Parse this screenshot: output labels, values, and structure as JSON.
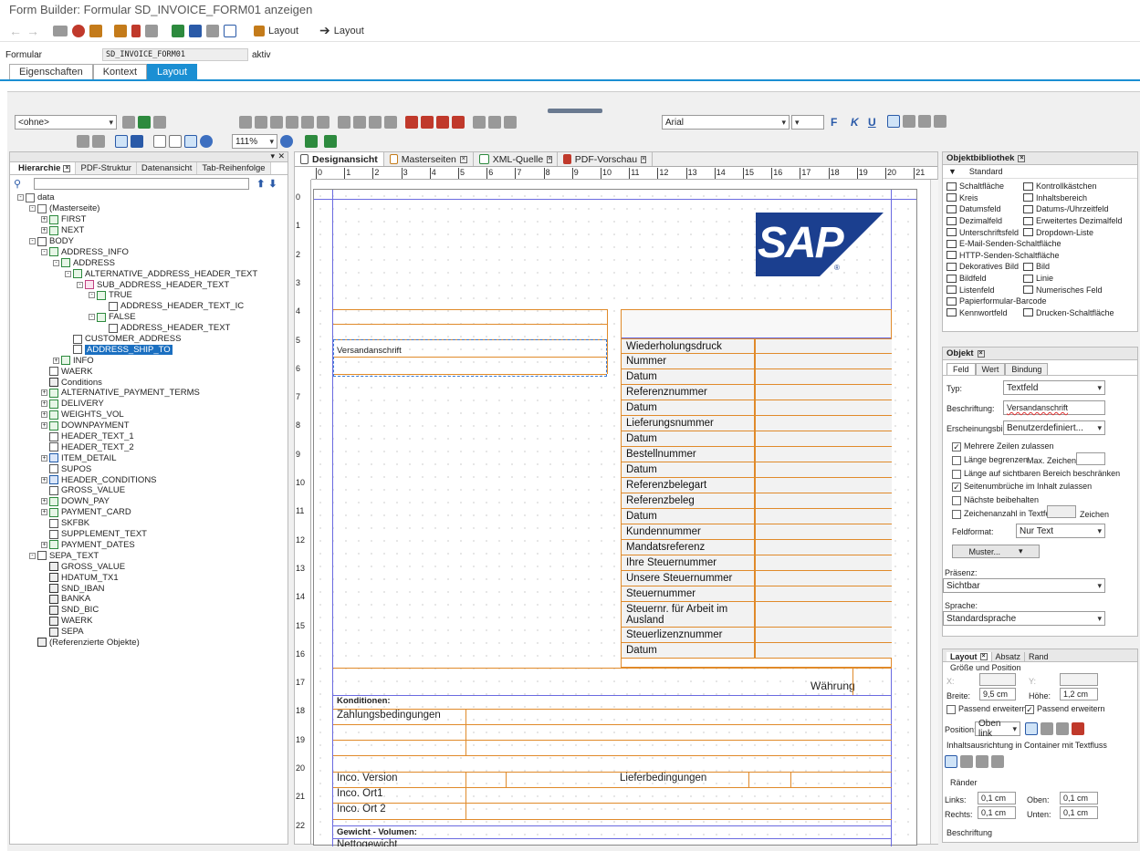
{
  "window": {
    "title": "Form Builder: Formular SD_INVOICE_FORM01 anzeigen"
  },
  "toolbar": {
    "layout_btn_1": "Layout",
    "layout_btn_2": "Layout"
  },
  "form": {
    "label": "Formular",
    "value": "SD_INVOICE_FORM01",
    "status": "aktiv"
  },
  "main_tabs": [
    {
      "label": "Eigenschaften"
    },
    {
      "label": "Kontext"
    },
    {
      "label": "Layout"
    }
  ],
  "design_toolbar": {
    "style_select": "<ohne>",
    "zoom": "111%",
    "font": "Arial"
  },
  "format_buttons": {
    "bold": "F",
    "italic": "K",
    "underline": "U"
  },
  "left_tabs": [
    {
      "label": "Hierarchie"
    },
    {
      "label": "PDF-Struktur"
    },
    {
      "label": "Datenansicht"
    },
    {
      "label": "Tab-Reihenfolge"
    }
  ],
  "tree": [
    {
      "label": "data",
      "level": 0,
      "icon": "page",
      "exp": "-"
    },
    {
      "label": "(Masterseite)",
      "level": 1,
      "icon": "page",
      "exp": "-"
    },
    {
      "label": "FIRST",
      "level": 2,
      "icon": "sub",
      "exp": "+"
    },
    {
      "label": "NEXT",
      "level": 2,
      "icon": "sub",
      "exp": "+"
    },
    {
      "label": "BODY",
      "level": 1,
      "icon": "fld",
      "exp": "-"
    },
    {
      "label": "ADDRESS_INFO",
      "level": 2,
      "icon": "sub",
      "exp": "-"
    },
    {
      "label": "ADDRESS",
      "level": 3,
      "icon": "sub",
      "exp": "-"
    },
    {
      "label": "ALTERNATIVE_ADDRESS_HEADER_TEXT",
      "level": 4,
      "icon": "sub",
      "exp": "-"
    },
    {
      "label": "SUB_ADDRESS_HEADER_TEXT",
      "level": 5,
      "icon": "pg",
      "exp": "-"
    },
    {
      "label": "TRUE",
      "level": 6,
      "icon": "sub",
      "exp": "-"
    },
    {
      "label": "ADDRESS_HEADER_TEXT_IC",
      "level": 7,
      "icon": "fld",
      "exp": ""
    },
    {
      "label": "FALSE",
      "level": 6,
      "icon": "sub",
      "exp": "-"
    },
    {
      "label": "ADDRESS_HEADER_TEXT",
      "level": 7,
      "icon": "fld",
      "exp": ""
    },
    {
      "label": "CUSTOMER_ADDRESS",
      "level": 4,
      "icon": "fld",
      "exp": ""
    },
    {
      "label": "ADDRESS_SHIP_TO",
      "level": 4,
      "icon": "fld",
      "exp": "",
      "selected": true
    },
    {
      "label": "INFO",
      "level": 3,
      "icon": "sub",
      "exp": "+"
    },
    {
      "label": "WAERK",
      "level": 2,
      "icon": "fld",
      "exp": ""
    },
    {
      "label": "Conditions",
      "level": 2,
      "icon": "tx",
      "exp": ""
    },
    {
      "label": "ALTERNATIVE_PAYMENT_TERMS",
      "level": 2,
      "icon": "sub",
      "exp": "+"
    },
    {
      "label": "DELIVERY",
      "level": 2,
      "icon": "sub",
      "exp": "+"
    },
    {
      "label": "WEIGHTS_VOL",
      "level": 2,
      "icon": "sub",
      "exp": "+"
    },
    {
      "label": "DOWNPAYMENT",
      "level": 2,
      "icon": "sub",
      "exp": "+"
    },
    {
      "label": "HEADER_TEXT_1",
      "level": 2,
      "icon": "fld",
      "exp": ""
    },
    {
      "label": "HEADER_TEXT_2",
      "level": 2,
      "icon": "fld",
      "exp": ""
    },
    {
      "label": "ITEM_DETAIL",
      "level": 2,
      "icon": "img",
      "exp": "+"
    },
    {
      "label": "SUPOS",
      "level": 2,
      "icon": "fld",
      "exp": ""
    },
    {
      "label": "HEADER_CONDITIONS",
      "level": 2,
      "icon": "img",
      "exp": "+"
    },
    {
      "label": "GROSS_VALUE",
      "level": 2,
      "icon": "fld",
      "exp": ""
    },
    {
      "label": "DOWN_PAY",
      "level": 2,
      "icon": "sub",
      "exp": "+"
    },
    {
      "label": "PAYMENT_CARD",
      "level": 2,
      "icon": "sub",
      "exp": "+"
    },
    {
      "label": "SKFBK",
      "level": 2,
      "icon": "fld",
      "exp": ""
    },
    {
      "label": "SUPPLEMENT_TEXT",
      "level": 2,
      "icon": "fld",
      "exp": ""
    },
    {
      "label": "PAYMENT_DATES",
      "level": 2,
      "icon": "sub",
      "exp": "+"
    },
    {
      "label": "SEPA_TEXT",
      "level": 1,
      "icon": "fld",
      "exp": "-"
    },
    {
      "label": "GROSS_VALUE",
      "level": 2,
      "icon": "tx",
      "exp": ""
    },
    {
      "label": "HDATUM_TX1",
      "level": 2,
      "icon": "tx",
      "exp": ""
    },
    {
      "label": "SND_IBAN",
      "level": 2,
      "icon": "tx",
      "exp": ""
    },
    {
      "label": "BANKA",
      "level": 2,
      "icon": "tx",
      "exp": ""
    },
    {
      "label": "SND_BIC",
      "level": 2,
      "icon": "tx",
      "exp": ""
    },
    {
      "label": "WAERK",
      "level": 2,
      "icon": "tx",
      "exp": ""
    },
    {
      "label": "SEPA",
      "level": 2,
      "icon": "tx",
      "exp": ""
    },
    {
      "label": "(Referenzierte Objekte)",
      "level": 1,
      "icon": "tx",
      "exp": ""
    }
  ],
  "canvas_tabs": [
    {
      "label": "Designansicht"
    },
    {
      "label": "Masterseiten"
    },
    {
      "label": "XML-Quelle"
    },
    {
      "label": "PDF-Vorschau"
    }
  ],
  "ruler_h": [
    "0",
    "1",
    "2",
    "3",
    "4",
    "5",
    "6",
    "7",
    "8",
    "9",
    "10",
    "11",
    "12",
    "13",
    "14",
    "15",
    "16",
    "17",
    "18",
    "19",
    "20",
    "21"
  ],
  "ruler_v": [
    "0",
    "1",
    "2",
    "3",
    "4",
    "5",
    "6",
    "7",
    "8",
    "9",
    "10",
    "11",
    "12",
    "13",
    "14",
    "15",
    "16",
    "17",
    "18",
    "19",
    "20",
    "21",
    "22"
  ],
  "logo": {
    "text": "SAP",
    "mark": "®",
    "color": "#1b3f8f"
  },
  "form_fields": {
    "versandanschrift": "Versandanschrift",
    "info": [
      "Wiederholungsdruck",
      "Nummer",
      "Datum",
      "Referenznummer",
      "Datum",
      "Lieferungsnummer",
      "Datum",
      "Bestellnummer",
      "Datum",
      "Referenzbelegart",
      "Referenzbeleg",
      "Datum",
      "Kundennummer",
      "Mandatsreferenz",
      "Ihre Steuernummer",
      "Unsere Steuernummer",
      "Steuernummer",
      "Steuernr. für Arbeit im Ausland",
      "Steuerlizenznummer",
      "Datum"
    ],
    "waehrung": "Währung",
    "konditionen": "Konditionen:",
    "zahlungsbedingungen": "Zahlungsbedingungen",
    "inco_version": "Inco. Version",
    "lieferbedingungen": "Lieferbedingungen",
    "inco_ort1": "Inco. Ort1",
    "inco_ort2": "Inco. Ort 2",
    "gewicht": "Gewicht - Volumen:",
    "nettogewicht": "Nettogewicht"
  },
  "library": {
    "title": "Objektbibliothek",
    "group": "Standard",
    "items": [
      "Schaltfläche",
      "Kontrollkästchen",
      "Kreis",
      "Inhaltsbereich",
      "Datumsfeld",
      "Datums-/Uhrzeitfeld",
      "Dezimalfeld",
      "Erweitertes Dezimalfeld",
      "Unterschriftsfeld",
      "Dropdown-Liste",
      "E-Mail-Senden-Schaltfläche",
      "",
      "HTTP-Senden-Schaltfläche",
      "",
      "Dekoratives Bild",
      "Bild",
      "Bildfeld",
      "Linie",
      "Listenfeld",
      "Numerisches Feld",
      "Papierformular-Barcode",
      "",
      "Kennwortfeld",
      "Drucken-Schaltfläche"
    ]
  },
  "object": {
    "title": "Objekt",
    "tabs": [
      "Feld",
      "Wert",
      "Bindung"
    ],
    "typ_label": "Typ:",
    "typ_value": "Textfeld",
    "beschriftung_label": "Beschriftung:",
    "beschriftung_value": "Versandanschrift",
    "erscheinungsbild_label": "Erscheinungsbild:",
    "erscheinungsbild_value": "Benutzerdefiniert...",
    "mehrere_zeilen": "Mehrere Zeilen zulassen",
    "laenge_begrenzen": "Länge begrenzen",
    "max_zeichen": "Max. Zeichen:",
    "laenge_sichtbar": "Länge auf sichtbaren Bereich beschränken",
    "seitenumbrueche": "Seitenumbrüche im Inhalt zulassen",
    "naechste": "Nächste beibehalten",
    "zeichenanzahl": "Zeichenanzahl in Textfeld",
    "zeichen": "Zeichen",
    "feldformat_label": "Feldformat:",
    "feldformat_value": "Nur Text",
    "muster": "Muster...",
    "praesenz_label": "Präsenz:",
    "praesenz_value": "Sichtbar",
    "sprache_label": "Sprache:",
    "sprache_value": "Standardsprache"
  },
  "layout": {
    "tabs": [
      "Layout",
      "Absatz",
      "Rand"
    ],
    "groesse": "Größe und Position",
    "x_label": "X:",
    "y_label": "Y:",
    "breite_label": "Breite:",
    "breite_value": "9,5 cm",
    "hoehe_label": "Höhe:",
    "hoehe_value": "1,2 cm",
    "passend1": "Passend erweitern",
    "passend2": "Passend erweitern",
    "position_label": "Position:",
    "position_value": "Oben link",
    "inhaltsausrichtung": "Inhaltsausrichtung in Container mit Textfluss",
    "raender": "Ränder",
    "links_label": "Links:",
    "links_value": "0,1 cm",
    "oben_label": "Oben:",
    "oben_value": "0,1 cm",
    "rechts_label": "Rechts:",
    "rechts_value": "0,1 cm",
    "unten_label": "Unten:",
    "unten_value": "0,1 cm",
    "beschriftung": "Beschriftung"
  }
}
